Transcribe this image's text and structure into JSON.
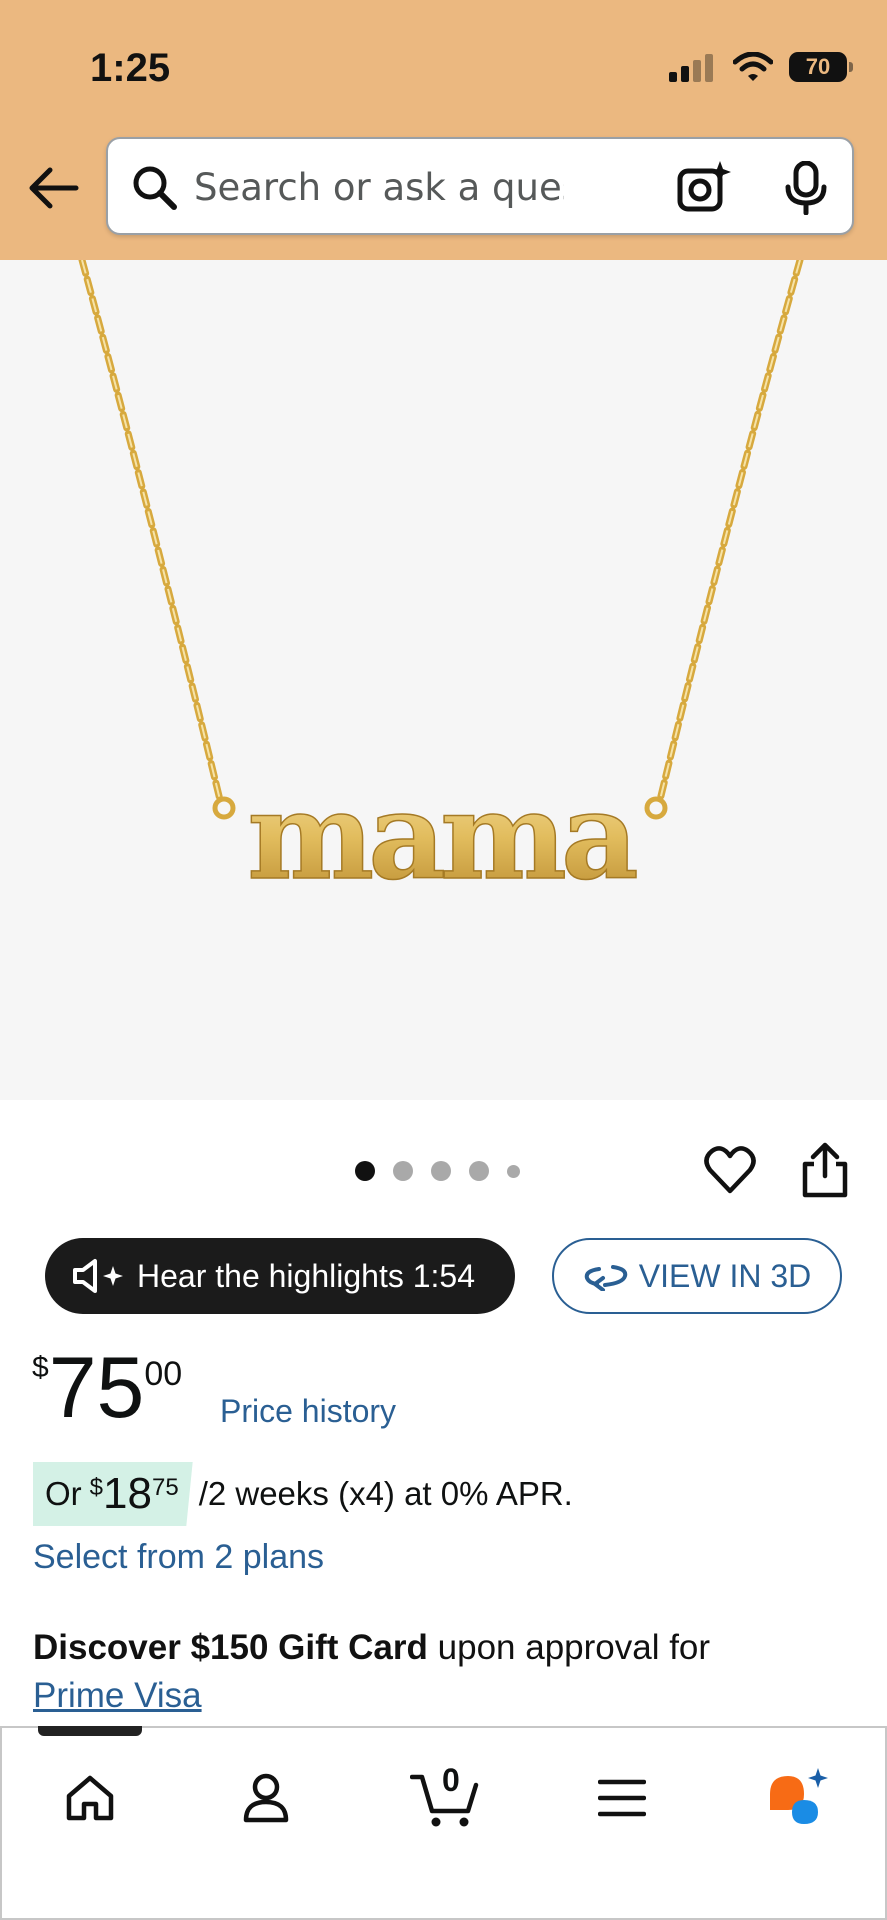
{
  "status_bar": {
    "time": "1:25",
    "battery": "70"
  },
  "search": {
    "placeholder": "Search or ask a question"
  },
  "product": {
    "image_text": "mama",
    "carousel": {
      "count": 5,
      "active": 0
    }
  },
  "actions": {
    "hear_label": "Hear the highlights 1:54",
    "view3d_label": "VIEW IN 3D"
  },
  "price": {
    "currency": "$",
    "whole": "75",
    "fraction": "00",
    "history_label": "Price history"
  },
  "installment": {
    "prefix": "Or",
    "currency": "$",
    "whole": "18",
    "fraction": "75",
    "terms": "/2 weeks (x4) at 0% APR.",
    "select_label": "Select from 2 plans"
  },
  "promo": {
    "bold": "Discover $150 Gift Card",
    "rest": "upon approval for",
    "link": "Prime Visa"
  },
  "cart": {
    "count": "0"
  },
  "colors": {
    "header": "#EBB880",
    "link": "#2a5f93",
    "installment_bg": "#d4f1e6",
    "gold": "#E8C46A"
  }
}
